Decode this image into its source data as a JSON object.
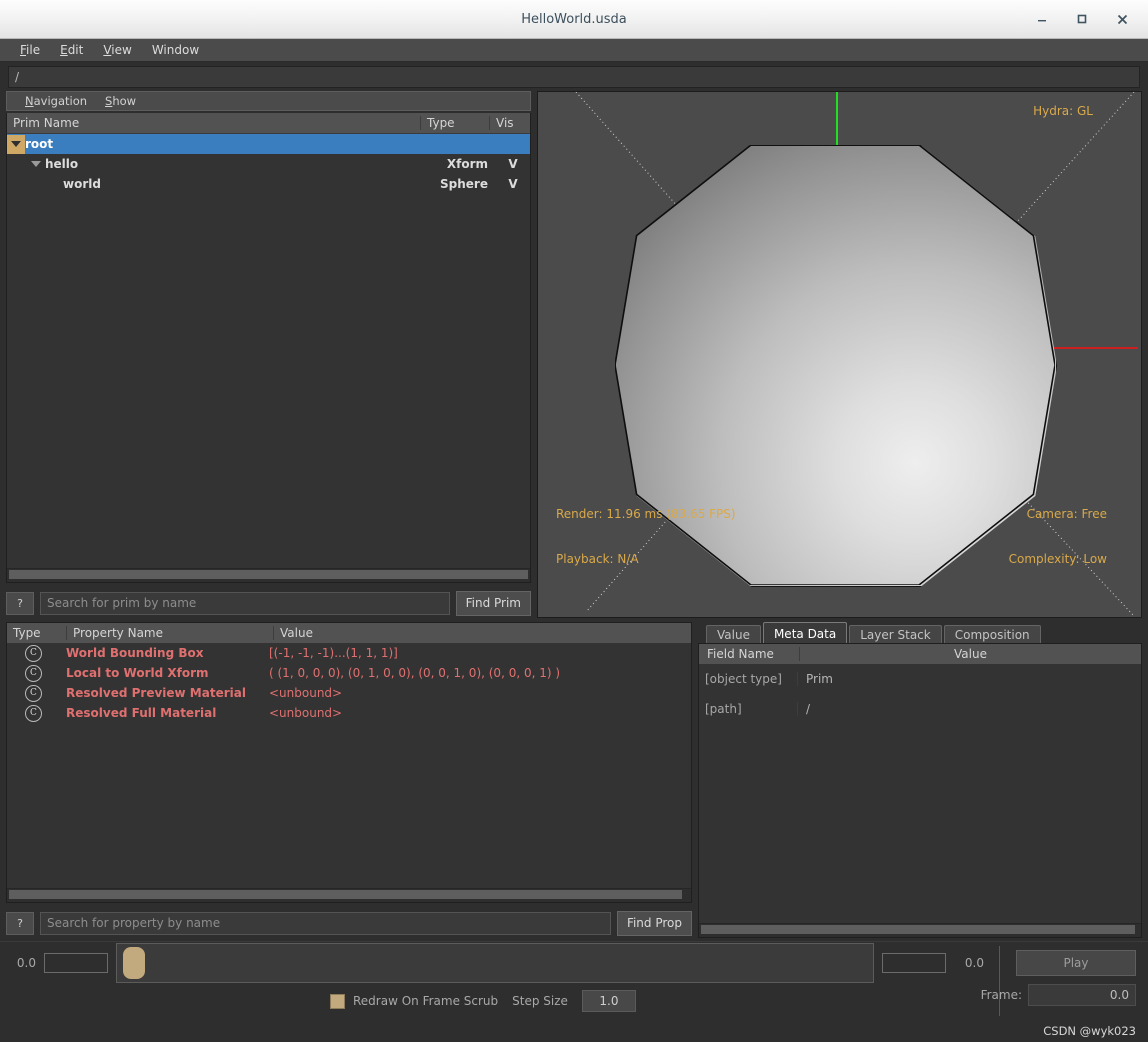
{
  "window": {
    "title": "HelloWorld.usda",
    "minimize_icon": "minimize-icon",
    "maximize_icon": "maximize-icon",
    "close_icon": "close-icon"
  },
  "menubar": {
    "items": [
      {
        "mnemonic": "F",
        "rest": "ile"
      },
      {
        "mnemonic": "E",
        "rest": "dit"
      },
      {
        "mnemonic": "V",
        "rest": "iew"
      },
      {
        "mnemonic": "",
        "rest": "Window"
      }
    ]
  },
  "pathbar": {
    "value": "/"
  },
  "prim_panel": {
    "menus": [
      {
        "mnemonic": "N",
        "rest": "avigation"
      },
      {
        "mnemonic": "S",
        "rest": "how"
      }
    ],
    "columns": {
      "name": "Prim Name",
      "type": "Type",
      "vis": "Vis"
    },
    "rows": [
      {
        "label": "root",
        "type": "",
        "vis": "",
        "depth": 0,
        "selected": true,
        "expanded": true
      },
      {
        "label": "hello",
        "type": "Xform",
        "vis": "V",
        "depth": 1,
        "selected": false,
        "expanded": true
      },
      {
        "label": "world",
        "type": "Sphere",
        "vis": "V",
        "depth": 2,
        "selected": false,
        "expanded": false
      }
    ],
    "search": {
      "help_label": "?",
      "placeholder": "Search for prim by name",
      "value": "",
      "find_button": "Find Prim"
    }
  },
  "viewport": {
    "hydra": "Hydra: GL",
    "render": "Render: 11.96 ms (83.65 FPS)",
    "playback": "Playback: N/A",
    "camera": "Camera: Free",
    "complexity": "Complexity: Low",
    "colors": {
      "axis_y": "#22dd22",
      "axis_x": "#cc2020",
      "overlay_text": "#d9a94a",
      "background": "#4b4b4b"
    }
  },
  "property_panel": {
    "columns": {
      "type": "Type",
      "name": "Property Name",
      "value": "Value"
    },
    "rows": [
      {
        "icon": "circle-c-icon",
        "name": "World Bounding Box",
        "value": "[(-1, -1, -1)...(1, 1, 1)]"
      },
      {
        "icon": "circle-c-icon",
        "name": "Local to World Xform",
        "value": "( (1, 0, 0, 0), (0, 1, 0, 0), (0, 0, 1, 0), (0, 0, 0, 1) )"
      },
      {
        "icon": "circle-c-icon",
        "name": "Resolved Preview Material",
        "value": "<unbound>"
      },
      {
        "icon": "circle-c-icon",
        "name": "Resolved Full Material",
        "value": "<unbound>"
      }
    ],
    "search": {
      "help_label": "?",
      "placeholder": "Search for property by name",
      "value": "",
      "find_button": "Find Prop"
    }
  },
  "meta_panel": {
    "tabs": [
      {
        "label": "Value",
        "active": false
      },
      {
        "label": "Meta Data",
        "active": true
      },
      {
        "label": "Layer Stack",
        "active": false
      },
      {
        "label": "Composition",
        "active": false
      }
    ],
    "columns": {
      "field": "Field Name",
      "value": "Value"
    },
    "rows": [
      {
        "field": "[object type]",
        "value": "Prim"
      },
      {
        "field": "[path]",
        "value": "/"
      }
    ]
  },
  "playback": {
    "start_value": "0.0",
    "end_value": "0.0",
    "play_label": "Play",
    "frame_label": "Frame:",
    "frame_value": "0.0",
    "redraw_label": "Redraw On Frame Scrub",
    "step_label": "Step Size",
    "step_value": "1.0"
  },
  "watermark": "CSDN @wyk023"
}
